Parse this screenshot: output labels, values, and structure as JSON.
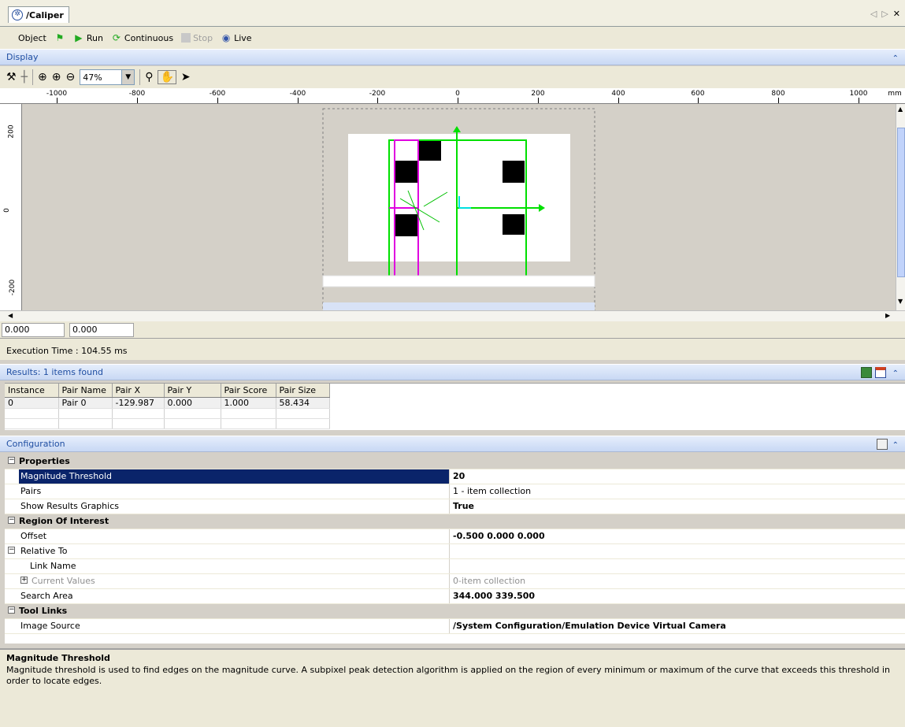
{
  "tab": {
    "title": "/Caliper"
  },
  "toolbar": {
    "object_label": "Object",
    "run_label": "Run",
    "continuous_label": "Continuous",
    "stop_label": "Stop",
    "live_label": "Live"
  },
  "display": {
    "header": "Display",
    "zoom": "47%",
    "ruler_unit": "mm",
    "h_ruler": [
      "-1000",
      "-800",
      "-600",
      "-400",
      "-200",
      "0",
      "200",
      "400",
      "600",
      "800",
      "1000"
    ],
    "v_ruler": [
      "200",
      "0",
      "-200"
    ],
    "coord_x": "0.000",
    "coord_y": "0.000",
    "execution_time": "Execution Time : 104.55 ms"
  },
  "results": {
    "header": "Results: 1 items found",
    "columns": [
      "Instance",
      "Pair Name",
      "Pair X",
      "Pair Y",
      "Pair Score",
      "Pair Size"
    ],
    "rows": [
      [
        "0",
        "Pair 0",
        "-129.987",
        "0.000",
        "1.000",
        "58.434"
      ]
    ]
  },
  "configuration": {
    "header": "Configuration",
    "categories": {
      "properties": "Properties",
      "roi": "Region Of Interest",
      "tool_links": "Tool Links"
    },
    "rows": {
      "magnitude_threshold": {
        "name": "Magnitude Threshold",
        "value": "20"
      },
      "pairs": {
        "name": "Pairs",
        "value": "1 - item collection"
      },
      "show_graphics": {
        "name": "Show Results Graphics",
        "value": "True"
      },
      "offset": {
        "name": "Offset",
        "value": "-0.500 0.000 0.000"
      },
      "relative_to": {
        "name": "Relative To",
        "value": ""
      },
      "link_name": {
        "name": "Link Name",
        "value": ""
      },
      "current_values": {
        "name": "Current Values",
        "value": "0-item collection"
      },
      "search_area": {
        "name": "Search Area",
        "value": "344.000 339.500"
      },
      "image_source": {
        "name": "Image Source",
        "value": "/System Configuration/Emulation Device Virtual Camera"
      }
    }
  },
  "description": {
    "title": "Magnitude Threshold",
    "text": "Magnitude threshold is used to find edges on the magnitude curve. A subpixel peak detection algorithm is applied on the region of every minimum or maximum of the curve that exceeds this threshold in order to locate edges."
  },
  "colors": {
    "header_text": "#1f4ea2",
    "selection": "#0a246a",
    "caliper_green": "#00e000",
    "caliper_magenta": "#e000e0"
  }
}
